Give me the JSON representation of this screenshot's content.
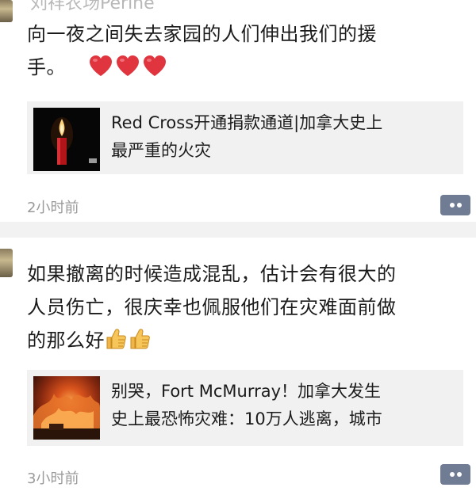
{
  "feed": {
    "posts": [
      {
        "author": "刘祥农场Perine",
        "text_line1": "向一夜之间失去家园的人们伸出我们的援",
        "text_line2": "手。",
        "emoji_icons": [
          "heart-icon",
          "heart-icon",
          "heart-icon"
        ],
        "link": {
          "thumbnail_icon": "candle-icon",
          "title_line1": "Red Cross开通捐款通道|加拿大史上",
          "title_line2": "最严重的火灾"
        },
        "timestamp": "2小时前",
        "comment_icon": "comment-icon"
      },
      {
        "text_line1": "如果撤离的时候造成混乱，估计会有很大的",
        "text_line2": "人员伤亡，很庆幸也佩服他们在灾难面前做",
        "text_line3": "的那么好",
        "emoji_icons": [
          "thumbs-up-icon",
          "thumbs-up-icon"
        ],
        "link": {
          "thumbnail_icon": "fire-photo",
          "title_line1": "别哭，Fort McMurray！加拿大发生",
          "title_line2": "史上最恐怖灾难：10万人逃离，城市"
        },
        "timestamp": "3小时前",
        "comment_icon": "comment-icon"
      }
    ]
  },
  "colors": {
    "background": "#ffffff",
    "card_background": "#f1f1f1",
    "divider": "#f2f2f2",
    "text": "#1b1b1b",
    "timestamp": "#9a9a9a",
    "comment_button": "#6f7c94",
    "heart": "#e0353f",
    "thumb": "#f0b548"
  }
}
